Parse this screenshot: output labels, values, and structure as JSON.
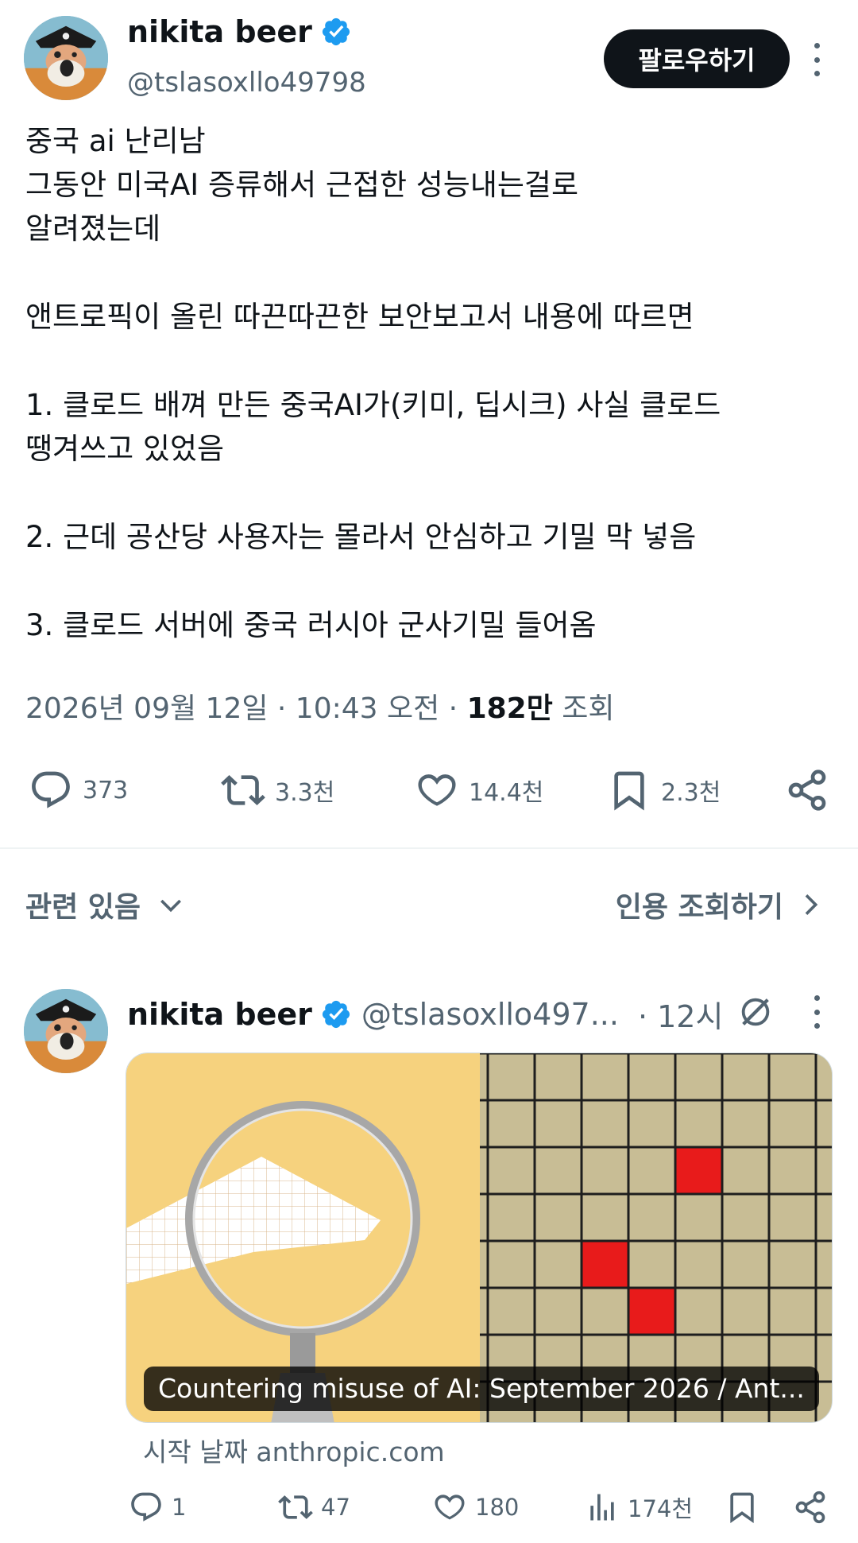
{
  "tweet": {
    "author_name": "nikita beer",
    "handle": "@tslasoxllo49798",
    "follow_label": "팔로우하기",
    "lines": [
      "중국 ai 난리남",
      "그동안 미국AI 증류해서 근접한 성능내는걸로",
      "알려졌는데",
      "",
      "앤트로픽이 올린 따끈따끈한 보안보고서 내용에 따르면",
      "",
      "1. 클로드 배껴 만든 중국AI가(키미, 딥시크) 사실 클로드",
      "땡겨쓰고 있었음",
      "",
      "2. 근데 공산당 사용자는 몰라서 안심하고 기밀 막 넣음",
      "",
      "3. 클로드 서버에 중국 러시아 군사기밀 들어옴"
    ],
    "date": "2026년 09월 12일 · 10:43 오전 · ",
    "views_count": "182만",
    "views_label": " 조회",
    "actions": {
      "replies": "373",
      "retweets": "3.3천",
      "likes": "14.4천",
      "bookmarks": "2.3천"
    }
  },
  "related": {
    "label": "관련 있음",
    "quote_label": "인용 조회하기"
  },
  "quoted_tweet": {
    "author_name": "nikita beer",
    "handle": "@tslasoxllo497...",
    "time": "· 12시",
    "card_caption": "Countering misuse of AI: September 2026 / Ant...",
    "source": "시작 날짜 anthropic.com",
    "actions": {
      "replies": "1",
      "retweets": "47",
      "likes": "180",
      "views": "174천"
    }
  },
  "colors": {
    "text_primary": "#0f1419",
    "text_secondary": "#536471",
    "verified_blue": "#1d9bf0",
    "card_yellow": "#f6d27e",
    "grid_red": "#e81b1b"
  },
  "icons": [
    "verified-badge-icon",
    "more-icon",
    "reply-icon",
    "retweet-icon",
    "like-icon",
    "bookmark-icon",
    "share-icon",
    "chevron-down-icon",
    "chevron-right-icon",
    "grok-icon",
    "views-icon"
  ]
}
